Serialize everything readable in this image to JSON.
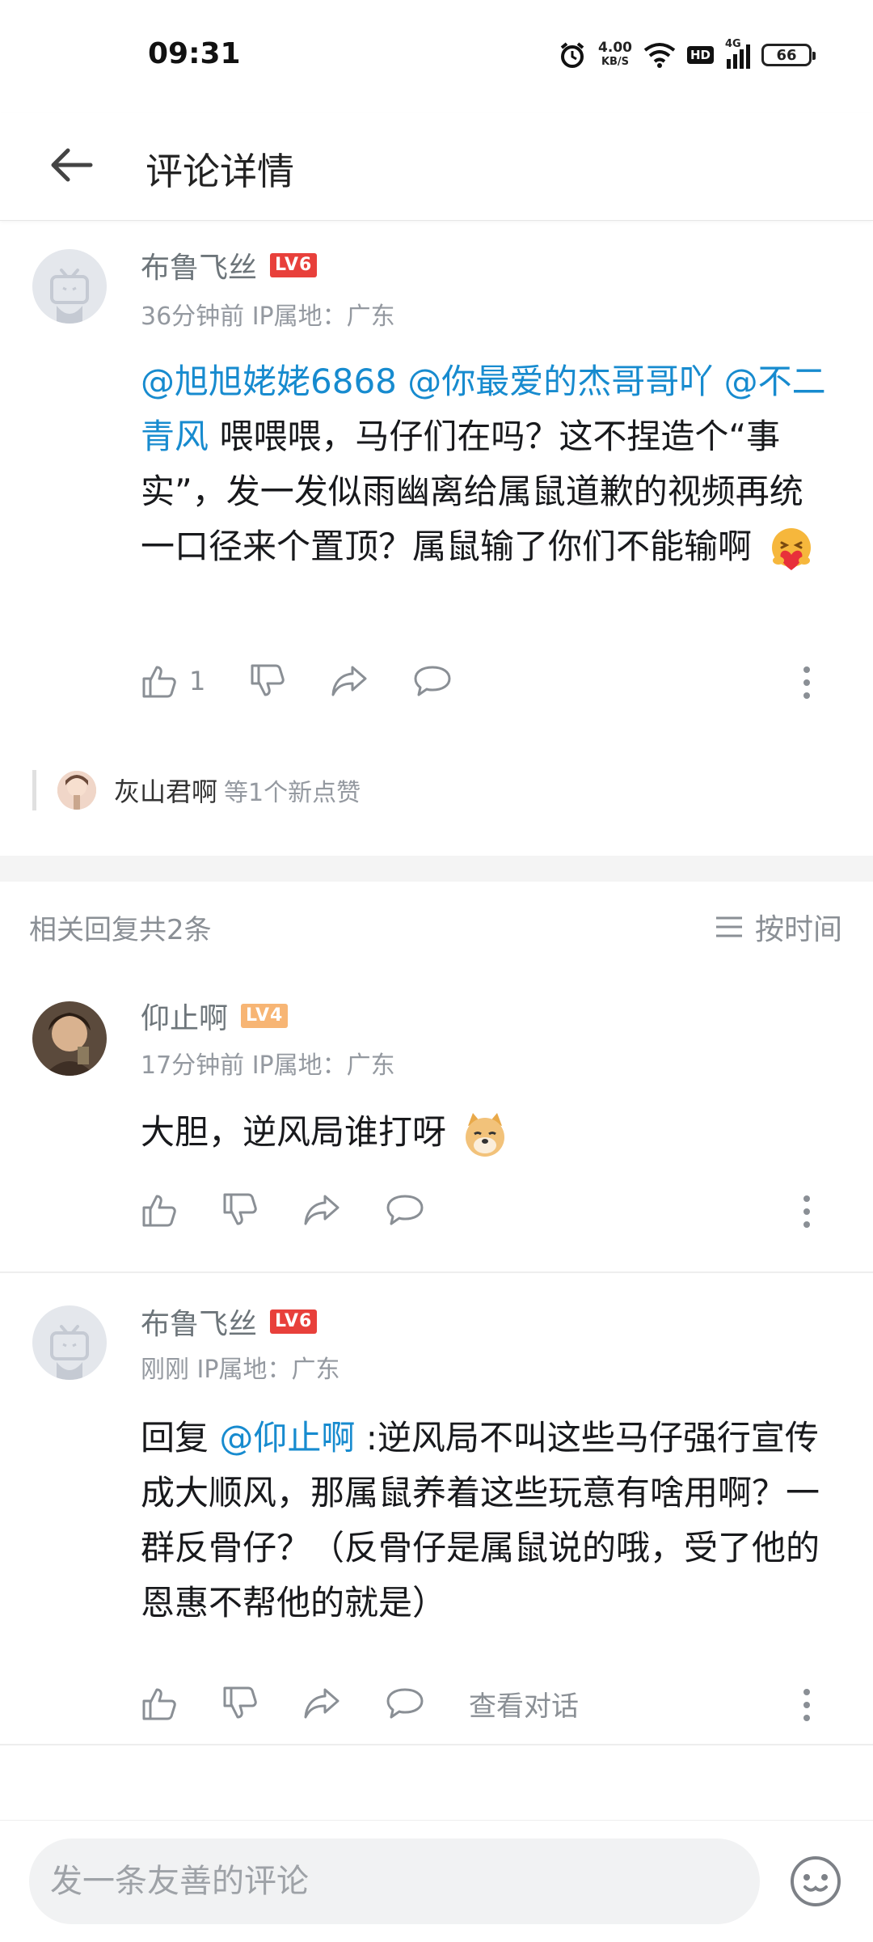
{
  "status_bar": {
    "time": "09:31",
    "net_speed": "4.00",
    "net_unit": "KB/S",
    "hd": "HD",
    "signal": "4G",
    "battery": "66"
  },
  "header": {
    "title": "评论详情"
  },
  "main_comment": {
    "username": "布鲁飞丝",
    "level": "LV6",
    "meta": "36分钟前  IP属地：广东",
    "mentions": [
      "@旭旭姥姥6868",
      "@你最爱的杰哥哥吖",
      "@不二青风"
    ],
    "text": " 喂喂喂，马仔们在吗？这不捏造个“事实”，发一发似雨幽离给属鼠道歉的视频再统一口径来个置顶？属鼠输了你们不能输啊",
    "like_count": "1",
    "emoji": "hug-heart-emoji"
  },
  "likers": {
    "name": "灰山君啊",
    "rest": "等1个新点赞"
  },
  "replies": {
    "count_label": "相关回复共2条",
    "sort_label": "按时间"
  },
  "reply1": {
    "username": "仰止啊",
    "level": "LV4",
    "meta": "17分钟前  IP属地：广东",
    "text": "大胆，逆风局谁打呀",
    "emoji": "doge-emoji"
  },
  "reply2": {
    "username": "布鲁飞丝",
    "level": "LV6",
    "meta": "刚刚  IP属地：广东",
    "reply_prefix": "回复 ",
    "mention": "@仰止啊",
    "text": " :逆风局不叫这些马仔强行宣传成大顺风，那属鼠养着这些玩意有啥用啊？一群反骨仔？（反骨仔是属鼠说的哦，受了他的恩惠不帮他的就是）",
    "view_conversation": "查看对话"
  },
  "bottom": {
    "placeholder": "发一条友善的评论"
  },
  "colors": {
    "mention": "#178bcf",
    "level6": "#e8403b",
    "level4": "#f7b574",
    "secondary_text": "#9499a0"
  }
}
